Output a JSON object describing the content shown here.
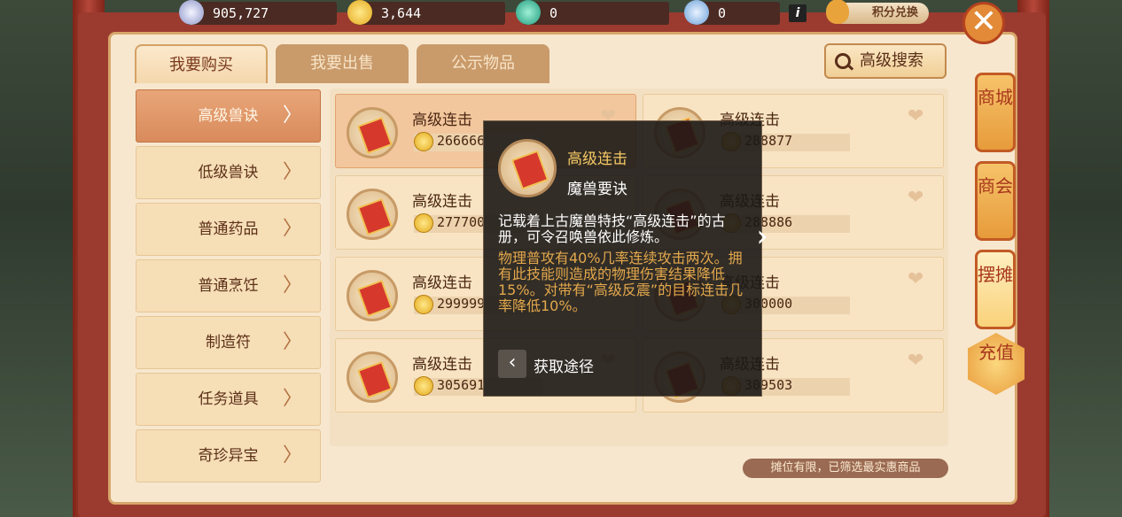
{
  "currency": {
    "silver": "905,727",
    "gold": "3,644",
    "jade": "0",
    "points": "0",
    "exchange_label": "积分兑换",
    "info_label": "i"
  },
  "tabs": [
    {
      "label": "我要购买",
      "active": true
    },
    {
      "label": "我要出售",
      "active": false
    },
    {
      "label": "公示物品",
      "active": false
    }
  ],
  "advanced_search_label": "高级搜索",
  "categories": [
    {
      "label": "高级兽诀",
      "active": true
    },
    {
      "label": "低级兽诀",
      "active": false
    },
    {
      "label": "普通药品",
      "active": false
    },
    {
      "label": "普通烹饪",
      "active": false
    },
    {
      "label": "制造符",
      "active": false
    },
    {
      "label": "任务道具",
      "active": false
    },
    {
      "label": "奇珍异宝",
      "active": false
    }
  ],
  "arrow": "〉",
  "items": [
    {
      "name": "高级连击",
      "price": "266666"
    },
    {
      "name": "高级连击",
      "price": "288877"
    },
    {
      "name": "高级连击",
      "price": "277700"
    },
    {
      "name": "高级连击",
      "price": "288886"
    },
    {
      "name": "高级连击",
      "price": "299999"
    },
    {
      "name": "高级连击",
      "price": "300000"
    },
    {
      "name": "高级连击",
      "price": "305691"
    },
    {
      "name": "高级连击",
      "price": "309503"
    }
  ],
  "tooltip": {
    "name": "高级连击",
    "type": "魔兽要诀",
    "description": "记载着上古魔兽特技“高级连击”的古册，可令召唤兽依此修炼。",
    "effect": "物理普攻有40%几率连续攻击两次。拥有此技能则造成的物理伤害结果降低15%。对带有“高级反震”的目标连击几率降低10%。",
    "source_label": "获取途径"
  },
  "footer_note": "摊位有限，已筛选最实惠商品",
  "side_buttons": [
    {
      "label": "商城"
    },
    {
      "label": "商会"
    },
    {
      "label": "摆摊"
    }
  ],
  "recharge_label": "充值",
  "colors": {
    "frame": "#9b3b2f",
    "panel": "#f7e7cf",
    "active_category": "#d98b5c",
    "tooltip_title": "#f5c964",
    "tooltip_effect": "#e3a84c"
  }
}
